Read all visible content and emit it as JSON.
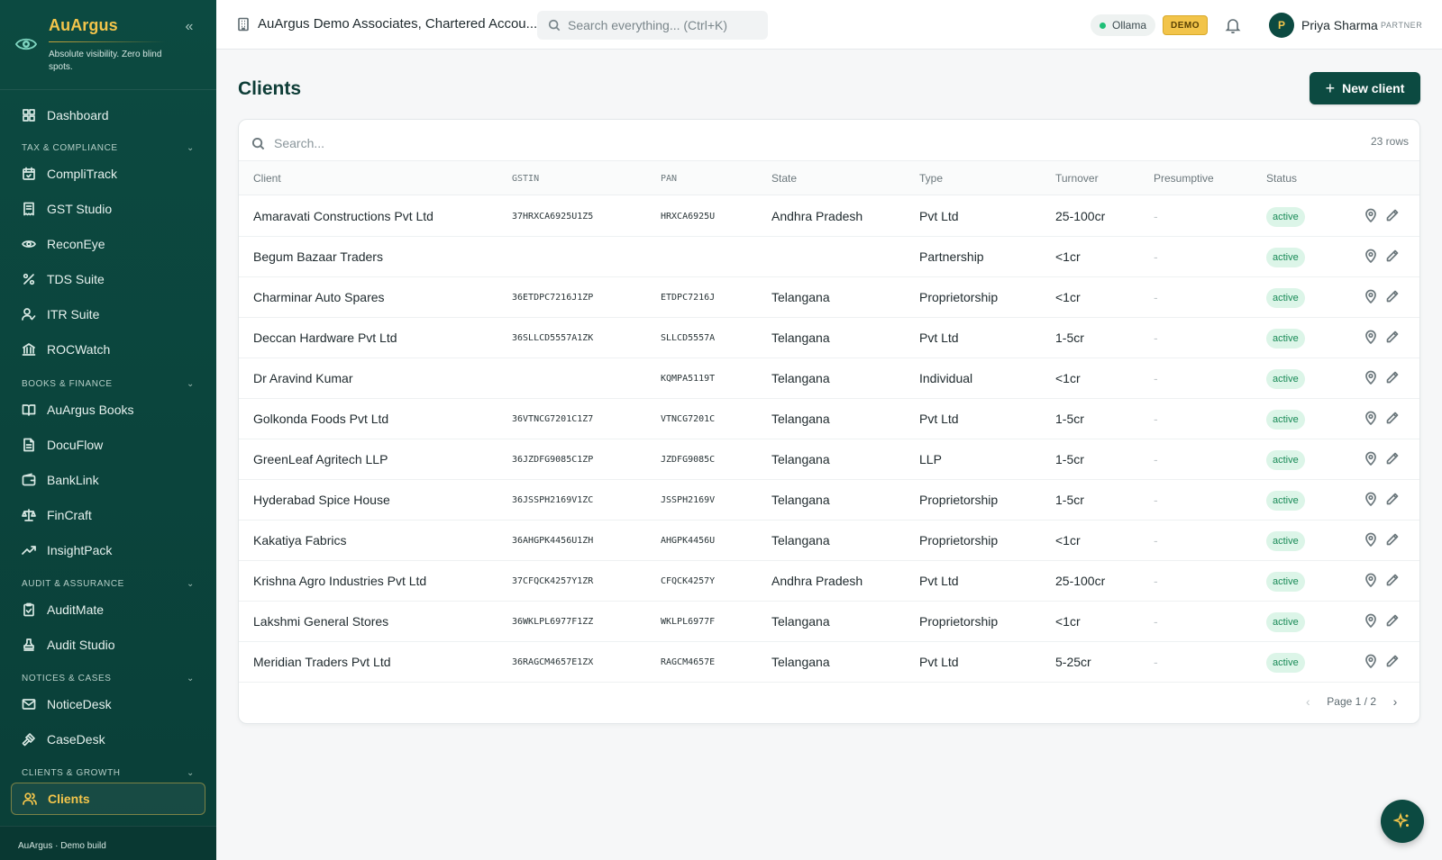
{
  "brand": {
    "name": "AuArgus",
    "tagline": "Absolute visibility. Zero blind spots.",
    "collapse_icon": "chevrons-left-icon"
  },
  "nav": {
    "dashboard": "Dashboard",
    "sections": [
      {
        "label": "TAX & COMPLIANCE",
        "items": [
          "CompliTrack",
          "GST Studio",
          "ReconEye",
          "TDS Suite",
          "ITR Suite",
          "ROCWatch"
        ]
      },
      {
        "label": "BOOKS & FINANCE",
        "items": [
          "AuArgus Books",
          "DocuFlow",
          "BankLink",
          "FinCraft",
          "InsightPack"
        ]
      },
      {
        "label": "AUDIT & ASSURANCE",
        "items": [
          "AuditMate",
          "Audit Studio"
        ]
      },
      {
        "label": "NOTICES & CASES",
        "items": [
          "NoticeDesk",
          "CaseDesk"
        ]
      },
      {
        "label": "CLIENTS & GROWTH",
        "items": [
          "Clients"
        ]
      }
    ],
    "active": "Clients",
    "footer": "AuArgus · Demo build"
  },
  "topbar": {
    "org_name": "AuArgus Demo Associates, Chartered Accou...",
    "search_placeholder": "Search everything... (Ctrl+K)",
    "llm_status": "Ollama",
    "demo_badge": "DEMO",
    "user_initial": "P",
    "user_name": "Priya Sharma",
    "user_role": "PARTNER"
  },
  "page": {
    "title": "Clients",
    "new_button": "New client",
    "table_search_placeholder": "Search...",
    "rows_count": "23 rows",
    "pagination": "Page 1 / 2"
  },
  "table": {
    "headers": [
      "Client",
      "GSTIN",
      "PAN",
      "State",
      "Type",
      "Turnover",
      "Presumptive",
      "Status"
    ],
    "rows": [
      {
        "client": "Amaravati Constructions Pvt Ltd",
        "gstin": "37HRXCA6925U1Z5",
        "pan": "HRXCA6925U",
        "state": "Andhra Pradesh",
        "type": "Pvt Ltd",
        "turnover": "25-100cr",
        "presumptive": "-",
        "status": "active"
      },
      {
        "client": "Begum Bazaar Traders",
        "gstin": "",
        "pan": "",
        "state": "",
        "type": "Partnership",
        "turnover": "<1cr",
        "presumptive": "-",
        "status": "active"
      },
      {
        "client": "Charminar Auto Spares",
        "gstin": "36ETDPC7216J1ZP",
        "pan": "ETDPC7216J",
        "state": "Telangana",
        "type": "Proprietorship",
        "turnover": "<1cr",
        "presumptive": "-",
        "status": "active"
      },
      {
        "client": "Deccan Hardware Pvt Ltd",
        "gstin": "36SLLCD5557A1ZK",
        "pan": "SLLCD5557A",
        "state": "Telangana",
        "type": "Pvt Ltd",
        "turnover": "1-5cr",
        "presumptive": "-",
        "status": "active"
      },
      {
        "client": "Dr Aravind Kumar",
        "gstin": "",
        "pan": "KQMPA5119T",
        "state": "Telangana",
        "type": "Individual",
        "turnover": "<1cr",
        "presumptive": "-",
        "status": "active"
      },
      {
        "client": "Golkonda Foods Pvt Ltd",
        "gstin": "36VTNCG7201C1Z7",
        "pan": "VTNCG7201C",
        "state": "Telangana",
        "type": "Pvt Ltd",
        "turnover": "1-5cr",
        "presumptive": "-",
        "status": "active"
      },
      {
        "client": "GreenLeaf Agritech LLP",
        "gstin": "36JZDFG9085C1ZP",
        "pan": "JZDFG9085C",
        "state": "Telangana",
        "type": "LLP",
        "turnover": "1-5cr",
        "presumptive": "-",
        "status": "active"
      },
      {
        "client": "Hyderabad Spice House",
        "gstin": "36JSSPH2169V1ZC",
        "pan": "JSSPH2169V",
        "state": "Telangana",
        "type": "Proprietorship",
        "turnover": "1-5cr",
        "presumptive": "-",
        "status": "active"
      },
      {
        "client": "Kakatiya Fabrics",
        "gstin": "36AHGPK4456U1ZH",
        "pan": "AHGPK4456U",
        "state": "Telangana",
        "type": "Proprietorship",
        "turnover": "<1cr",
        "presumptive": "-",
        "status": "active"
      },
      {
        "client": "Krishna Agro Industries Pvt Ltd",
        "gstin": "37CFQCK4257Y1ZR",
        "pan": "CFQCK4257Y",
        "state": "Andhra Pradesh",
        "type": "Pvt Ltd",
        "turnover": "25-100cr",
        "presumptive": "-",
        "status": "active"
      },
      {
        "client": "Lakshmi General Stores",
        "gstin": "36WKLPL6977F1ZZ",
        "pan": "WKLPL6977F",
        "state": "Telangana",
        "type": "Proprietorship",
        "turnover": "<1cr",
        "presumptive": "-",
        "status": "active"
      },
      {
        "client": "Meridian Traders Pvt Ltd",
        "gstin": "36RAGCM4657E1ZX",
        "pan": "RAGCM4657E",
        "state": "Telangana",
        "type": "Pvt Ltd",
        "turnover": "5-25cr",
        "presumptive": "-",
        "status": "active"
      }
    ]
  },
  "colors": {
    "sidebar": "#0c4a41",
    "accent": "#f3c54b",
    "status_active_bg": "#dcf5e8",
    "status_active_fg": "#198a57"
  }
}
